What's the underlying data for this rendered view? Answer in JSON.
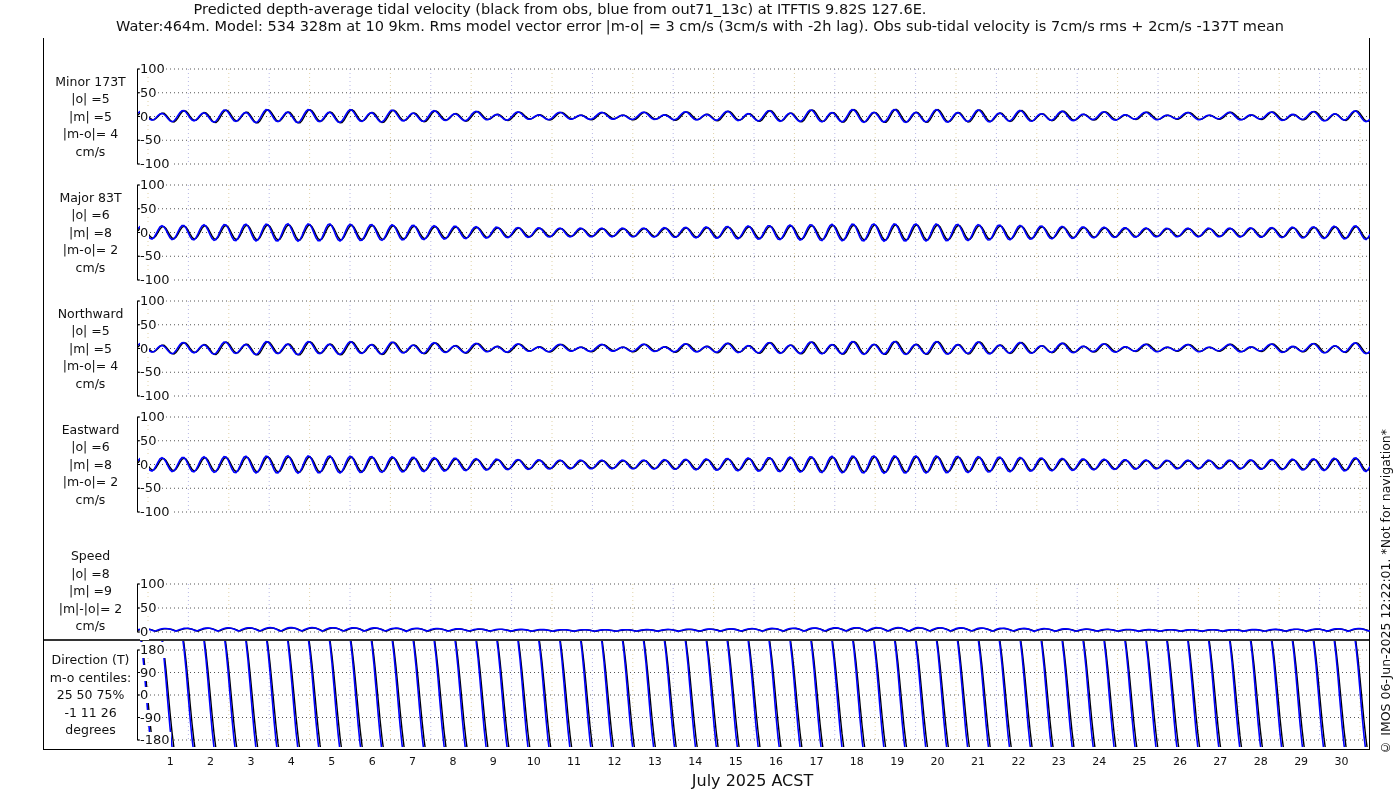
{
  "title": {
    "line_1": "Predicted depth-average tidal velocity (black from obs, blue from out71_13c) at ITFTIS 9.82S 127.6E.",
    "line_2": "Water:464m. Model: 534 328m at 10 9km. Rms model vector error |m-o| = 3 cm/s (3cm/s with -2h lag). Obs sub-tidal velocity is 7cm/s rms + 2cm/s -137T mean"
  },
  "panels": [
    {
      "kind": "small-wave",
      "label_lines": [
        "Minor 173T",
        "|o| =5",
        "|m| =5",
        "|m-o|= 4",
        "cm/s"
      ],
      "yticks": [
        "100",
        "50",
        "0",
        "-50",
        "-100"
      ]
    },
    {
      "kind": "large-wave",
      "label_lines": [
        "Major 83T",
        "|o| =6",
        "|m| =8",
        "|m-o|= 2",
        "cm/s"
      ],
      "yticks": [
        "100",
        "50",
        "0",
        "-50",
        "-100"
      ]
    },
    {
      "kind": "small-wave",
      "label_lines": [
        "Northward",
        "|o| =5",
        "|m| =5",
        "|m-o|= 4",
        "cm/s"
      ],
      "yticks": [
        "100",
        "50",
        "0",
        "-50",
        "-100"
      ]
    },
    {
      "kind": "large-wave",
      "label_lines": [
        "Eastward",
        "|o| =6",
        "|m| =8",
        "|m-o|= 2",
        "cm/s"
      ],
      "yticks": [
        "100",
        "50",
        "0",
        "-50",
        "-100"
      ]
    },
    {
      "kind": "speed",
      "label_lines": [
        "Speed",
        "|o| =8",
        "|m| =9",
        "|m|-|o|= 2",
        "cm/s"
      ],
      "yticks": [
        "100",
        "50",
        "0"
      ]
    },
    {
      "kind": "direction",
      "label_lines": [
        "Direction (T)",
        "m-o centiles:",
        "25  50  75%",
        "-1  11  26",
        "degrees"
      ],
      "yticks": [
        "180",
        "90",
        "0",
        "-90",
        "-180"
      ]
    }
  ],
  "days": [
    "1",
    "2",
    "3",
    "4",
    "5",
    "6",
    "7",
    "8",
    "9",
    "10",
    "11",
    "12",
    "13",
    "14",
    "15",
    "16",
    "17",
    "18",
    "19",
    "20",
    "21",
    "22",
    "23",
    "24",
    "25",
    "26",
    "27",
    "28",
    "29",
    "30"
  ],
  "xlabel": "July 2025 ACST",
  "credit": "© IMOS 06-Jun-2025 12:22:01. *Not for navigation*"
}
